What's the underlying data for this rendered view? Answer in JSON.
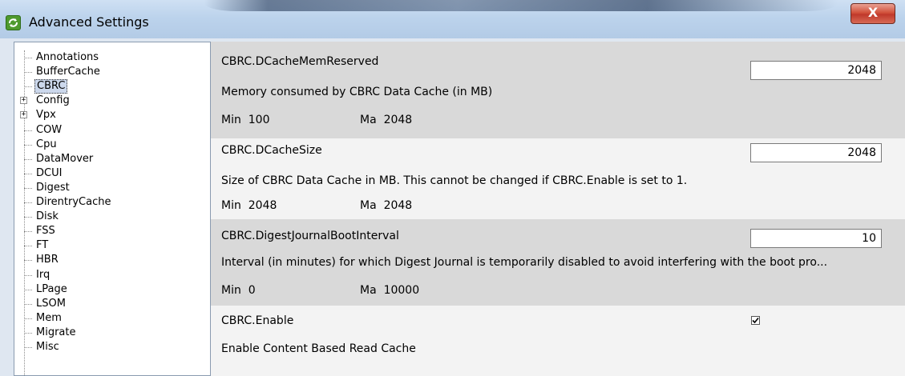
{
  "window": {
    "title": "Advanced Settings",
    "close_label": "X"
  },
  "tree": {
    "items": [
      {
        "label": "Annotations",
        "expandable": false
      },
      {
        "label": "BufferCache",
        "expandable": false
      },
      {
        "label": "CBRC",
        "expandable": false,
        "selected": true
      },
      {
        "label": "Config",
        "expandable": true
      },
      {
        "label": "Vpx",
        "expandable": true
      },
      {
        "label": "COW",
        "expandable": false
      },
      {
        "label": "Cpu",
        "expandable": false
      },
      {
        "label": "DataMover",
        "expandable": false
      },
      {
        "label": "DCUI",
        "expandable": false
      },
      {
        "label": "Digest",
        "expandable": false
      },
      {
        "label": "DirentryCache",
        "expandable": false
      },
      {
        "label": "Disk",
        "expandable": false
      },
      {
        "label": "FSS",
        "expandable": false
      },
      {
        "label": "FT",
        "expandable": false
      },
      {
        "label": "HBR",
        "expandable": false
      },
      {
        "label": "Irq",
        "expandable": false
      },
      {
        "label": "LPage",
        "expandable": false
      },
      {
        "label": "LSOM",
        "expandable": false
      },
      {
        "label": "Mem",
        "expandable": false
      },
      {
        "label": "Migrate",
        "expandable": false
      },
      {
        "label": "Misc",
        "expandable": false
      }
    ],
    "expander_glyph": "+"
  },
  "settings": [
    {
      "name": "CBRC.DCacheMemReserved",
      "description": "Memory consumed by CBRC Data Cache (in MB)",
      "value": "2048",
      "min_label": "Min",
      "min_value": "100",
      "max_label": "Ma",
      "max_value": "2048",
      "type": "text"
    },
    {
      "name": "CBRC.DCacheSize",
      "description": "Size of CBRC Data Cache in MB. This cannot be changed if CBRC.Enable is set to 1.",
      "value": "2048",
      "min_label": "Min",
      "min_value": "2048",
      "max_label": "Ma",
      "max_value": "2048",
      "type": "text"
    },
    {
      "name": "CBRC.DigestJournalBootInterval",
      "description": "Interval (in minutes) for which Digest Journal is temporarily disabled to avoid interfering with the boot pro...",
      "value": "10",
      "min_label": "Min",
      "min_value": "0",
      "max_label": "Ma",
      "max_value": "10000",
      "type": "text"
    },
    {
      "name": "CBRC.Enable",
      "description": "Enable Content Based Read Cache",
      "checked": true,
      "type": "checkbox"
    }
  ],
  "colors": {
    "row_shade": "#d9d9d9",
    "row_plain": "#f3f3f3",
    "selected_bg": "#ccd8ec",
    "close_button": "#c0392b"
  }
}
